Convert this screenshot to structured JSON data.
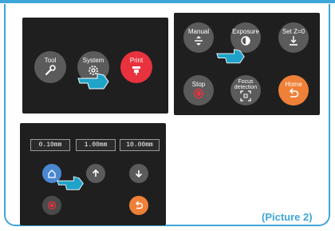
{
  "panel1": {
    "tool_label": "Tool",
    "system_label": "System",
    "print_label": "Print"
  },
  "panel2": {
    "manual_label": "Manual",
    "exposure_label": "Exposure",
    "setz_label": "Set Z=0",
    "stop_label": "Stop",
    "focus_label": "Focus detection",
    "home_label": "Home"
  },
  "panel3": {
    "steps": [
      "0.10mm",
      "1.00mm",
      "10.00mm"
    ]
  },
  "caption": "(Picture 2)",
  "colors": {
    "accent_blue": "#3fa6d9",
    "print_red": "#e8323e",
    "home_orange": "#ef8037",
    "pointer_teal": "#1fa3c9"
  },
  "icons": [
    "wrench-icon",
    "gear-icon",
    "print-icon",
    "up-down-arrows-icon",
    "exposure-icon",
    "set-zero-icon",
    "stop-icon",
    "focus-icon",
    "back-icon",
    "home-icon",
    "arrow-up-icon",
    "arrow-down-icon",
    "hand-pointer-icon"
  ]
}
